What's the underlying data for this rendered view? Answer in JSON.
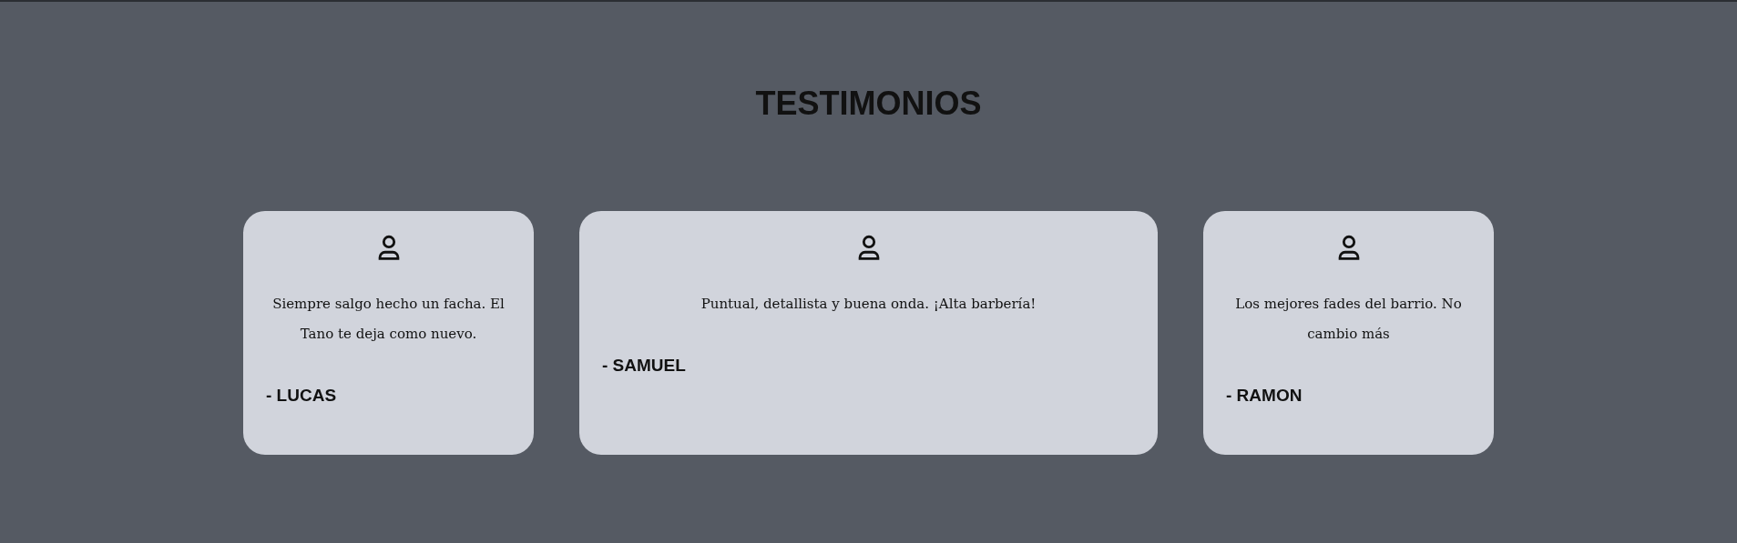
{
  "title": "TESTIMONIOS",
  "testimonials": [
    {
      "text": "Siempre salgo hecho un facha. El Tano te deja como nuevo.",
      "author": "- LUCAS",
      "wide": false
    },
    {
      "text": "Puntual, detallista y buena onda. ¡Alta barbería!",
      "author": "- SAMUEL",
      "wide": true
    },
    {
      "text": "Los mejores fades del barrio. No cambio más",
      "author": "- RAMON",
      "wide": false
    }
  ]
}
